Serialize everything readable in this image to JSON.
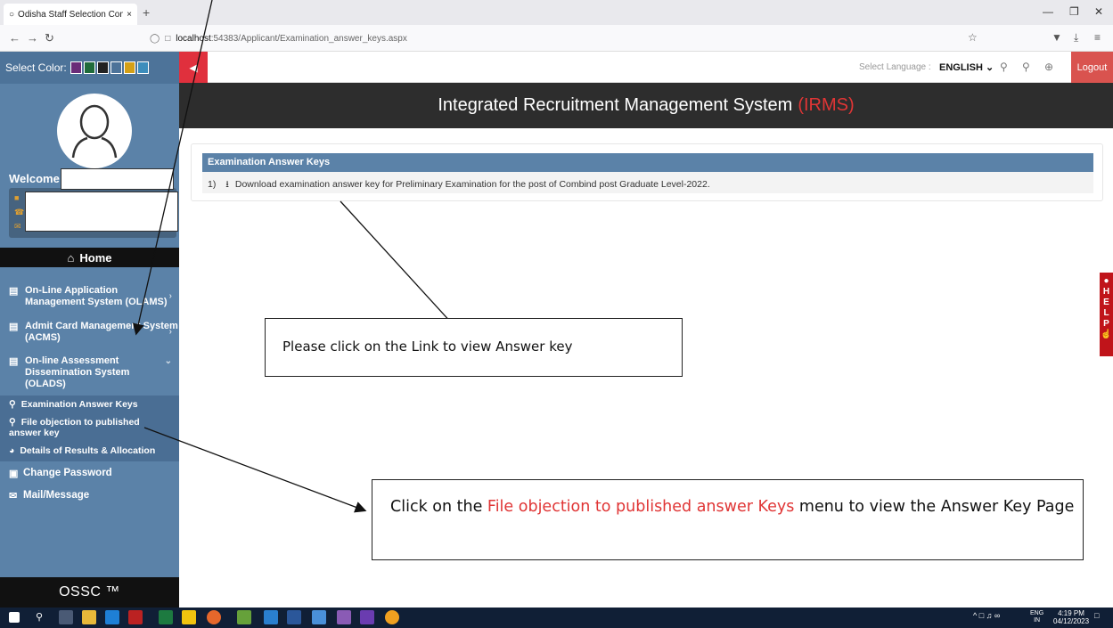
{
  "browser": {
    "tab_title": "Odisha Staff Selection Commis",
    "new_tab": "+",
    "url_prefix": "localhost",
    "url_rest": ":54383/Applicant/Examination_answer_keys.aspx"
  },
  "sidebar": {
    "select_color_label": "Select Color:",
    "swatches": [
      "#6a2c78",
      "#1f6b3a",
      "#222222",
      "#4d7399",
      "#d4a017",
      "#3c8dbc"
    ],
    "welcome": "Welcome",
    "home": "Home",
    "menu": [
      {
        "label": "On-Line Application Management System (OLAMS)"
      },
      {
        "label": "Admit Card Management System (ACMS)"
      },
      {
        "label": "On-line Assessment Dissemination System (OLADS)"
      }
    ],
    "submenu": [
      {
        "label": "Examination Answer Keys"
      },
      {
        "label": "File objection to published answer key"
      },
      {
        "label": "Details of Results & Allocation"
      }
    ],
    "change_password": "Change Password",
    "mail": "Mail/Message",
    "footer": "OSSC ™"
  },
  "header": {
    "select_language_label": "Select Language :",
    "language": "ENGLISH",
    "logout": "Logout",
    "title": "Integrated Recruitment Management System",
    "title_accent": "(IRMS)"
  },
  "content": {
    "panel_title": "Examination Answer Keys",
    "row_number": "1)",
    "row_text": "Download examination answer key for Preliminary Examination for the post of Combind post Graduate Level-2022."
  },
  "help_letters": [
    "H",
    "E",
    "L",
    "P"
  ],
  "annotations": {
    "callout1": "Please click on the Link to view Answer key",
    "callout2_pre": "Click on the ",
    "callout2_highlight": "File objection to published answer Keys",
    "callout2_post": " menu to view the Answer Key Page"
  },
  "taskbar": {
    "lang": "ENG",
    "region": "IN",
    "time": "4:19 PM",
    "date": "04/12/2023"
  }
}
